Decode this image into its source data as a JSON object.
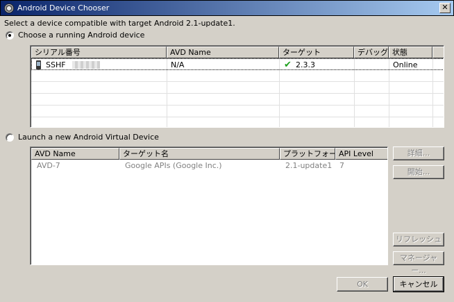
{
  "window": {
    "title": "Android Device Chooser",
    "close_glyph": "✕"
  },
  "prompt": "Select a device compatible with target Android 2.1-update1.",
  "running": {
    "radio_label": "Choose a running Android device",
    "selected": true,
    "columns": [
      "シリアル番号",
      "AVD Name",
      "ターゲット",
      "デバッグ",
      "状態"
    ],
    "rows": [
      {
        "serial": "SSHF",
        "avd_name": "N/A",
        "target": "2.3.3",
        "debug": "",
        "state": "Online"
      }
    ]
  },
  "launch": {
    "radio_label": "Launch a new Android Virtual Device",
    "selected": false,
    "columns": [
      "AVD Name",
      "ターゲット名",
      "プラットフォー...",
      "API Level"
    ],
    "rows": [
      {
        "avd_name": "AVD-7",
        "target_name": "Google APIs (Google Inc.)",
        "platform": "2.1-update1",
        "api_level": "7"
      }
    ],
    "buttons": {
      "details": "詳細...",
      "start": "開始...",
      "refresh": "リフレッシュ",
      "manager": "マネージャー..."
    }
  },
  "footer": {
    "ok": "OK",
    "cancel": "キャンセル"
  },
  "icons": {
    "app": "gear-icon",
    "device": "phone-icon",
    "target_ok": "checkmark-icon"
  },
  "colors": {
    "titlebar_start": "#0a246a",
    "titlebar_end": "#a6caf0",
    "dialog_bg": "#d4d0c8",
    "check_green": "#1ea01e"
  }
}
